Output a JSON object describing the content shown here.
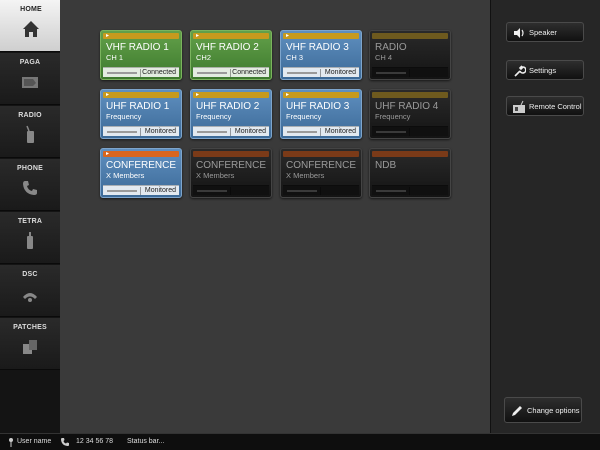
{
  "nav": {
    "items": [
      {
        "label": "HOME",
        "icon": "home-icon"
      },
      {
        "label": "PAGA",
        "icon": "megaphone-icon"
      },
      {
        "label": "RADIO",
        "icon": "radio-icon"
      },
      {
        "label": "PHONE",
        "icon": "phone-icon"
      },
      {
        "label": "TETRA",
        "icon": "tetra-handset-icon"
      },
      {
        "label": "DSC",
        "icon": "dsc-icon"
      },
      {
        "label": "PATCHES",
        "icon": "patches-icon"
      }
    ]
  },
  "tiles": [
    {
      "line1": "VHF RADIO 1",
      "line2": "CH 1",
      "status": "Connected",
      "style": "green"
    },
    {
      "line1": "VHF RADIO 2",
      "line2": "CH2",
      "status": "Connected",
      "style": "green"
    },
    {
      "line1": "VHF RADIO 3",
      "line2": "CH 3",
      "status": "Monitored",
      "style": "blue"
    },
    {
      "line1": "RADIO",
      "line2": "CH 4",
      "status": "",
      "style": "dark"
    },
    {
      "line1": "UHF RADIO 1",
      "line2": "Frequency",
      "status": "Monitored",
      "style": "blue"
    },
    {
      "line1": "UHF RADIO 2",
      "line2": "Frequency",
      "status": "Monitored",
      "style": "blue"
    },
    {
      "line1": "UHF RADIO 3",
      "line2": "Frequency",
      "status": "Monitored",
      "style": "blue"
    },
    {
      "line1": "UHF RADIO 4",
      "line2": "Frequency",
      "status": "",
      "style": "dark"
    },
    {
      "line1": "CONFERENCE",
      "line2": "X Members",
      "status": "Monitored",
      "style": "blue-conf"
    },
    {
      "line1": "CONFERENCE",
      "line2": "X Members",
      "status": "",
      "style": "dark-conf"
    },
    {
      "line1": "CONFERENCE",
      "line2": "X Members",
      "status": "",
      "style": "dark-conf"
    },
    {
      "line1": "NDB",
      "line2": "",
      "status": "",
      "style": "dark-conf"
    }
  ],
  "right_panel": {
    "speaker": "Speaker",
    "settings": "Settings",
    "remote_control": "Remote Control",
    "change_options": "Change options"
  },
  "status_bar": {
    "user": "User name",
    "phone": "12 34 56 78",
    "status": "Status bar..."
  },
  "colors": {
    "connected_green": "#4f8d3b",
    "monitored_blue": "#4a7aab",
    "strip_gold": "#c79a1e",
    "strip_orange": "#d9661e"
  }
}
